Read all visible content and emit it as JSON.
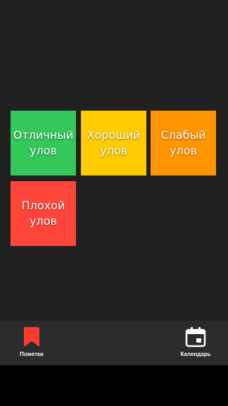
{
  "tiles": [
    {
      "label": "Отличный\nулов",
      "color": "#34c759"
    },
    {
      "label": "Хороший\nулов",
      "color": "#ffcc00"
    },
    {
      "label": "Слабый\nулов",
      "color": "#ff9500"
    },
    {
      "label": "Плохой\nулов",
      "color": "#ff453a"
    }
  ],
  "nav": {
    "notes": {
      "label": "Пометки",
      "icon": "bookmark-icon",
      "color": "#ff3b30"
    },
    "calendar": {
      "label": "Календарь",
      "icon": "calendar-icon",
      "color": "#ffffff"
    }
  }
}
